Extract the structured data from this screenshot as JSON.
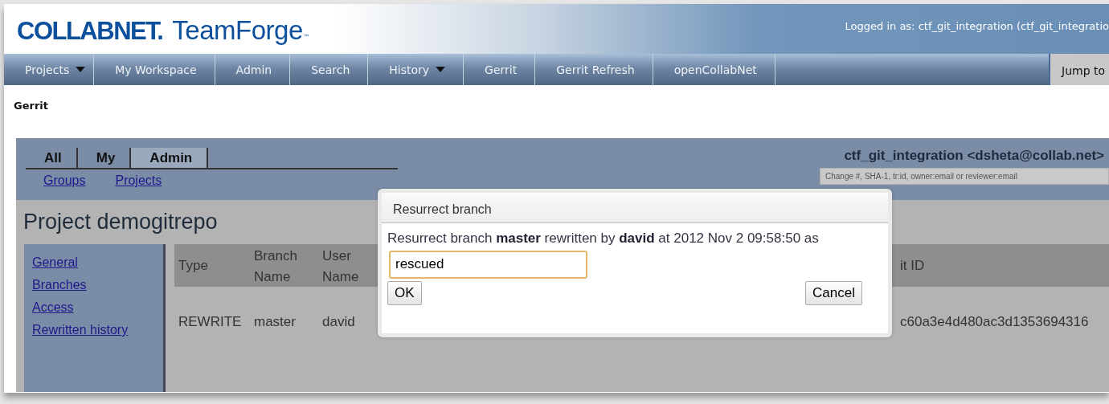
{
  "header": {
    "logo": {
      "brand": "COLLABNET",
      "mark": ".",
      "product": "TeamForge",
      "tm": "™"
    },
    "login_text": "Logged in as: ctf_git_integration (ctf_git_integratio"
  },
  "nav": {
    "items": [
      {
        "label": "Projects",
        "dropdown": true
      },
      {
        "label": "My Workspace",
        "dropdown": false
      },
      {
        "label": "Admin",
        "dropdown": false
      },
      {
        "label": "Search",
        "dropdown": false
      },
      {
        "label": "History",
        "dropdown": true
      },
      {
        "label": "Gerrit",
        "dropdown": false
      },
      {
        "label": "Gerrit Refresh",
        "dropdown": false
      },
      {
        "label": "openCollabNet",
        "dropdown": false
      }
    ],
    "jump_to": "Jump to"
  },
  "breadcrumb": "Gerrit",
  "gerrit": {
    "tabs": [
      {
        "label": "All",
        "selected": false
      },
      {
        "label": "My",
        "selected": false
      },
      {
        "label": "Admin",
        "selected": true
      }
    ],
    "sub_links": [
      "Groups",
      "Projects"
    ],
    "user": "ctf_git_integration <dsheta@collab.net>",
    "search": {
      "placeholder": "Change #, SHA-1, tr:id, owner:email or reviewer:email"
    },
    "page_title": "Project demogitrepo",
    "sidebar": {
      "items": [
        "General",
        "Branches",
        "Access",
        "Rewritten history"
      ]
    },
    "table": {
      "columns": [
        "Type",
        "Branch Name",
        "User Name",
        "it ID"
      ],
      "rows": [
        [
          "REWRITE",
          "master",
          "david",
          "c60a3e4d480ac3d1353694316"
        ]
      ]
    }
  },
  "dialog": {
    "title": "Resurrect branch",
    "message": "Resurrect branch **master** rewritten by **david** at 2012 Nov 2 09:58:50 as",
    "input": {
      "value": "rescued",
      "focused": true
    },
    "buttons": [
      "OK",
      "Cancel"
    ]
  }
}
